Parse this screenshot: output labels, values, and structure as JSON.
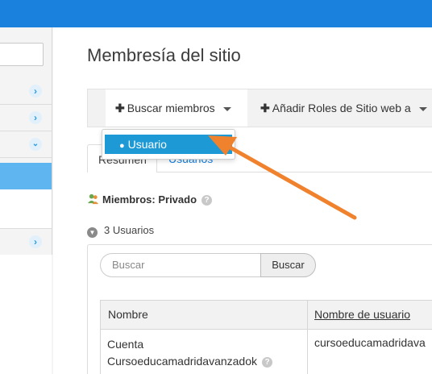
{
  "page": {
    "title": "Membresía del sitio"
  },
  "toolbar": {
    "search_members": "Buscar miembros",
    "add_roles": "Añadir Roles de Sitio web a"
  },
  "dropdown": {
    "items": [
      "Usuario"
    ]
  },
  "tabs": [
    {
      "label": "Resumen",
      "active": true
    },
    {
      "label": "Usuarios",
      "active": false
    }
  ],
  "members": {
    "label": "Miembros: Privado"
  },
  "users": {
    "count_label": "3 Usuarios",
    "search_placeholder": "Buscar",
    "search_button": "Buscar"
  },
  "table": {
    "headers": [
      "Nombre",
      "Nombre de usuario"
    ],
    "rows": [
      {
        "name_line1": "Cuenta",
        "name_line2": "Cursoeducamadridavanzadok",
        "username": "cursoeducamadridava"
      }
    ]
  },
  "colors": {
    "topbar": "#1a82dc",
    "accent": "#1d99d6",
    "arrow": "#f0822d",
    "sidebar_active": "#5eb5ef"
  },
  "icons": {
    "sidebar_chevrons": [
      "chevron-right-icon",
      "chevron-right-icon",
      "chevron-down-icon",
      "chevron-right-icon"
    ]
  }
}
